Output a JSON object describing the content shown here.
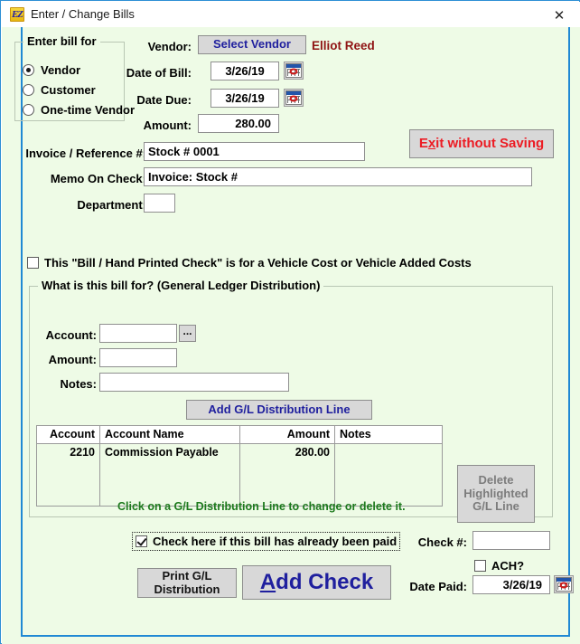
{
  "window": {
    "title": "Enter / Change Bills",
    "app_icon": "ez-logo-icon",
    "close_label": "✕"
  },
  "bill_for": {
    "legend": "Enter bill for",
    "options": [
      {
        "label": "Vendor",
        "selected": true
      },
      {
        "label": "Customer",
        "selected": false
      },
      {
        "label": "One-time Vendor",
        "selected": false
      }
    ]
  },
  "header_fields": {
    "vendor_label": "Vendor:",
    "select_vendor_button": "Select Vendor",
    "vendor_name": "Elliot Reed",
    "date_of_bill_label": "Date of Bill:",
    "date_of_bill_value": "3/26/19",
    "date_due_label": "Date Due:",
    "date_due_value": "3/26/19",
    "amount_label": "Amount:",
    "amount_value": "280.00",
    "invoice_label": "Invoice / Reference #:",
    "invoice_value": "Stock # 0001",
    "memo_label": "Memo On Check:",
    "memo_value": "Invoice: Stock #",
    "department_label": "Department:",
    "department_value": ""
  },
  "exit_button": {
    "prefix": "E",
    "accel": "x",
    "suffix": "it without Saving"
  },
  "vehicle_checkbox": {
    "label": "This \"Bill / Hand Printed Check\" is for a Vehicle Cost or Vehicle Added Costs",
    "checked": false
  },
  "gl_group": {
    "legend": "What is this bill for? (General Ledger Distribution)",
    "account_label": "Account:",
    "account_value": "",
    "lookup_button": "...",
    "amount_label": "Amount:",
    "amount_value": "",
    "notes_label": "Notes:",
    "notes_value": "",
    "add_line_button": "Add G/L Distribution Line",
    "delete_button_lines": [
      "Delete",
      "Highlighted",
      "G/L Line"
    ],
    "hint": "Click on a G/L Distribution Line to change or delete it.",
    "table": {
      "columns": [
        "Account",
        "Account Name",
        "Amount",
        "Notes"
      ],
      "rows": [
        {
          "account": "2210",
          "account_name": "Commission Payable",
          "amount": "280.00",
          "notes": ""
        }
      ]
    }
  },
  "payment": {
    "paid_checkbox_label": "Check here if this bill has already been paid",
    "paid_checked": true,
    "check_number_label": "Check #:",
    "check_number_value": "",
    "ach_label": "ACH?",
    "ach_checked": false,
    "date_paid_label": "Date Paid:",
    "date_paid_value": "3/26/19",
    "print_button_lines": [
      "Print G/L",
      "Distribution"
    ],
    "add_check_button": {
      "accel": "A",
      "rest": "dd Check"
    }
  }
}
